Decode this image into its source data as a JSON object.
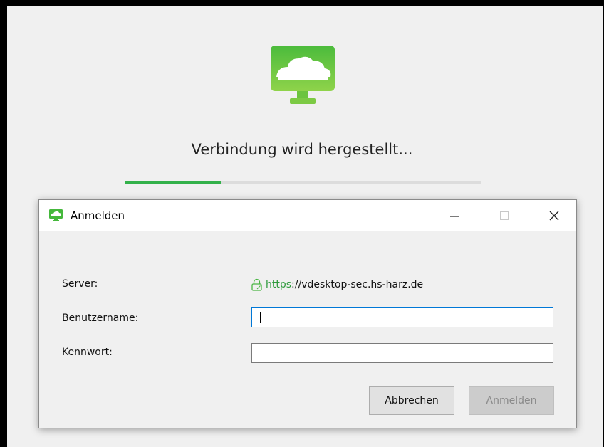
{
  "background": {
    "status_text": "Verbindung wird hergestellt...",
    "progress_percent": 27,
    "logo_icon": "cloud-monitor-icon",
    "accent_color": "#33b14a"
  },
  "dialog": {
    "title": "Anmelden",
    "title_icon": "cloud-monitor-icon",
    "window_controls": {
      "minimize_icon": "minimize-icon",
      "maximize_icon": "maximize-icon",
      "close_icon": "close-icon"
    },
    "server": {
      "label": "Server:",
      "icon": "lock-icon",
      "scheme": "https",
      "rest": "://vdesktop-sec.hs-harz.de"
    },
    "username": {
      "label": "Benutzername:",
      "value": ""
    },
    "password": {
      "label": "Kennwort:",
      "value": ""
    },
    "buttons": {
      "cancel_label": "Abbrechen",
      "login_label": "Anmelden"
    }
  }
}
